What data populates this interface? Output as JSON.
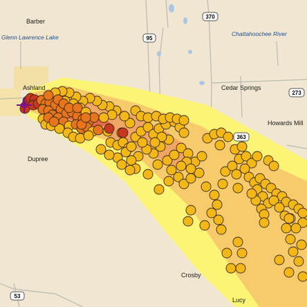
{
  "map": {
    "colors": {
      "land": "#f0e6d2",
      "road": "#b9b9b0",
      "water_text": "#1b4f8f",
      "place_text": "#1a1a1a",
      "plume_outer": "#fbf474",
      "plume_middle": "#f7cb6b",
      "plume_inner": "#f1a565",
      "plume_core": "#e26a4a",
      "marker_far": "#fbe31c",
      "marker_mid": "#f3b817",
      "marker_near": "#e7751c",
      "marker_close": "#c8381f",
      "source_marker": "#7c0f86"
    },
    "places": {
      "barber": "Barber",
      "dupree": "Dupree",
      "cedar_springs": "Cedar Springs",
      "howards_mill": "Howards Mill",
      "crosby": "Crosby",
      "lucy": "Lucy",
      "ashland": "Ashland"
    },
    "water": {
      "glenn_lawrence_lake": "Glenn Lawrence Lake",
      "chattahoochee_river": "Chattahoochee River"
    },
    "routes": {
      "r370": "370",
      "r95": "95",
      "r273": "273",
      "r363": "363",
      "r53": "53"
    }
  }
}
